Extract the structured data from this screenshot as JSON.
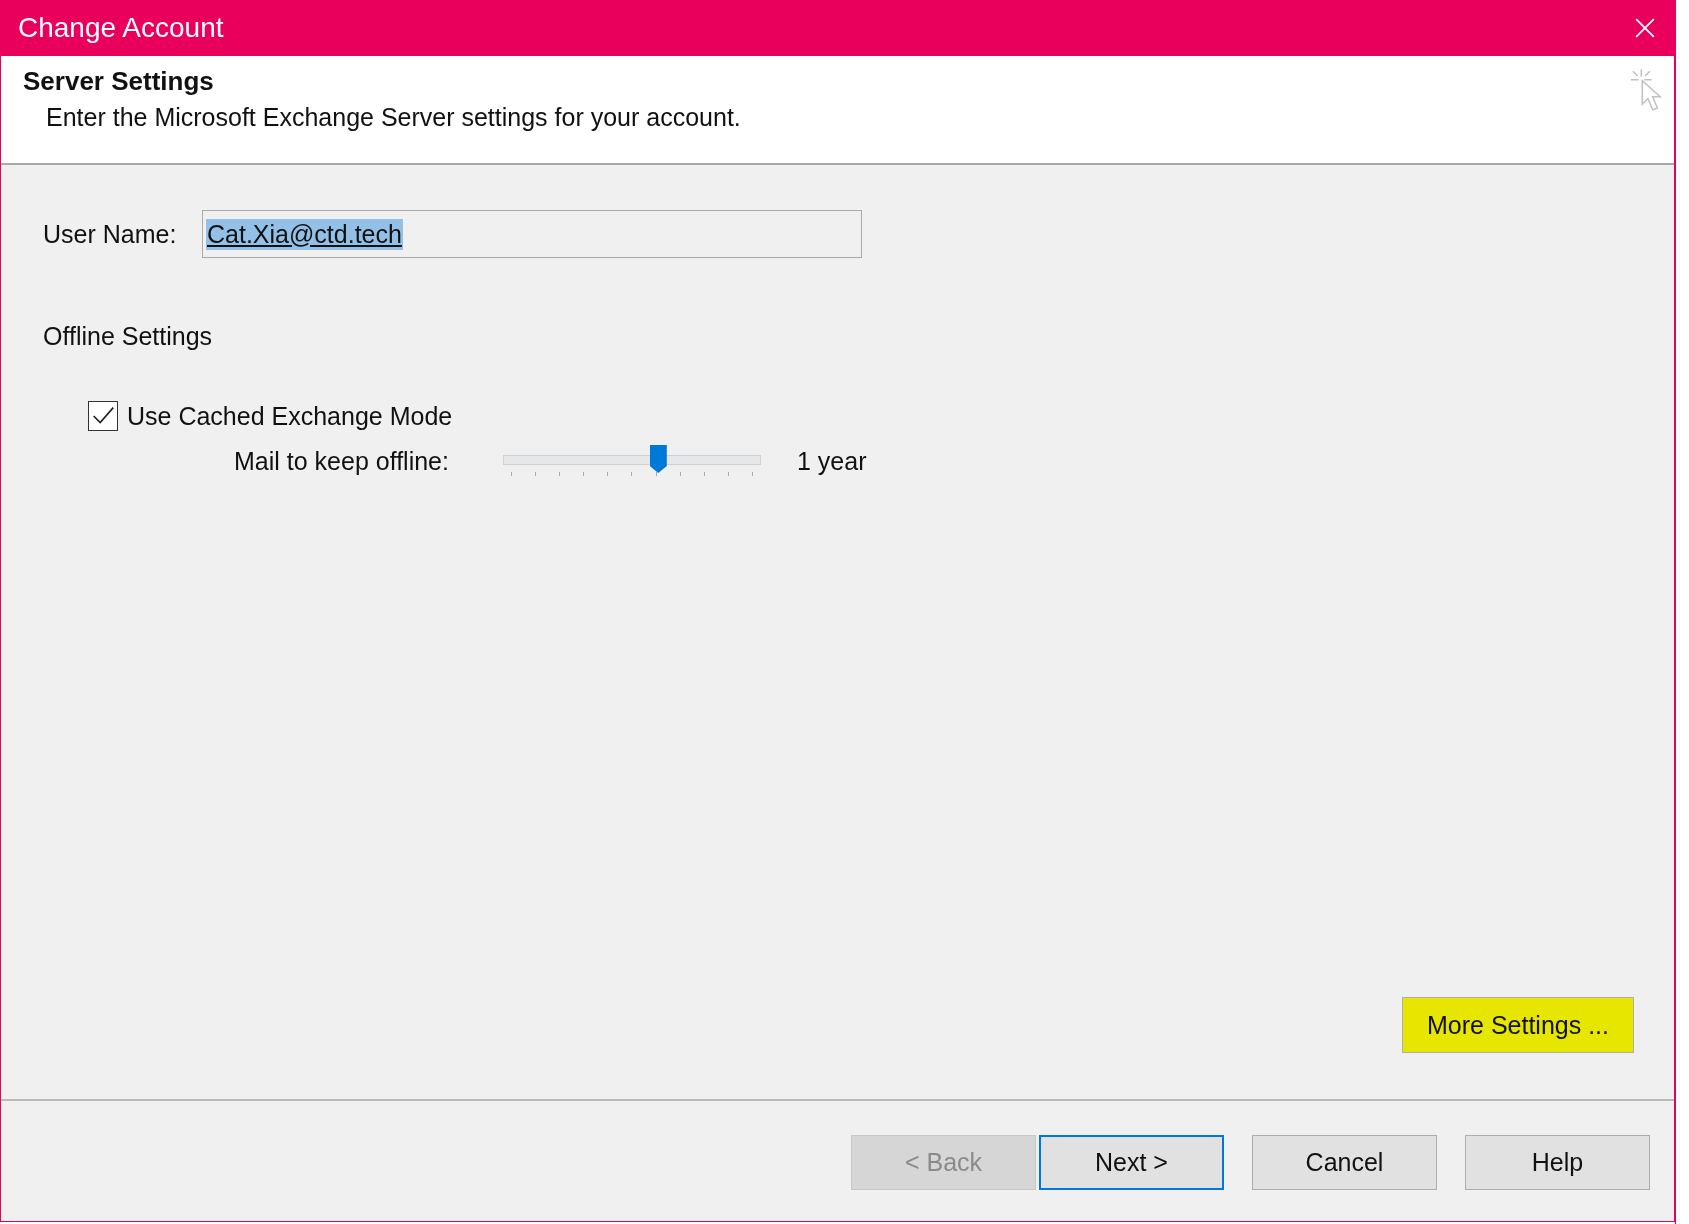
{
  "window": {
    "title": "Change Account"
  },
  "header": {
    "title": "Server Settings",
    "subtitle": "Enter the Microsoft Exchange Server settings for your account."
  },
  "user_name": {
    "label": "User Name:",
    "value": "Cat.Xia@ctd.tech",
    "selected": true
  },
  "offline": {
    "heading": "Offline Settings",
    "cached_mode": {
      "label": "Use Cached Exchange Mode",
      "checked": true
    },
    "mail_offline": {
      "label": "Mail to keep offline:",
      "level": 0.6,
      "reading": "1 year"
    }
  },
  "more_settings": {
    "label": "More Settings ...",
    "highlighted": true
  },
  "buttons": [
    {
      "label": "< Back",
      "disabled": true,
      "selected": false
    },
    {
      "label": "Next >",
      "disabled": false,
      "selected": true
    },
    {
      "label": "Cancel",
      "disabled": false,
      "selected": false
    },
    {
      "label": "Help",
      "disabled": false,
      "selected": false
    }
  ]
}
